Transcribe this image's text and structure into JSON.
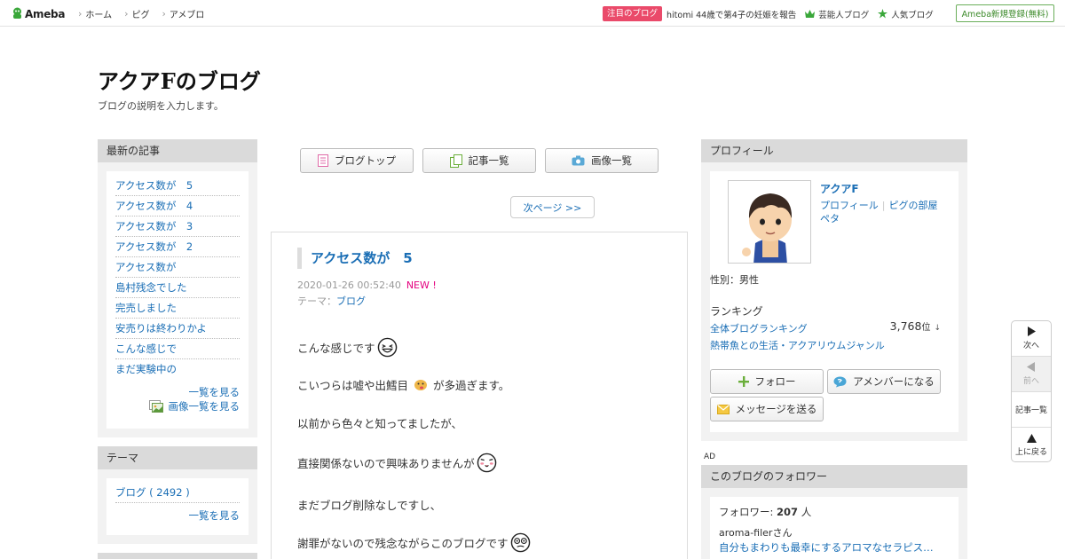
{
  "header": {
    "logo_text": "Ameba",
    "nav": [
      "ホーム",
      "ピグ",
      "アメブロ"
    ],
    "notice_badge": "注目のブログ",
    "notice_text": "hitomi 44歳で第4子の妊娠を報告",
    "celeb_blog": "芸能人ブログ",
    "popular_blog": "人気ブログ",
    "register": "Ameba新規登録(無料)"
  },
  "blog": {
    "title": "アクアFのブログ",
    "description": "ブログの説明を入力します。"
  },
  "recent": {
    "heading": "最新の記事",
    "items": [
      "アクセス数が　5",
      "アクセス数が　4",
      "アクセス数が　3",
      "アクセス数が　2",
      "アクセス数が",
      "島村残念でした",
      "完売しました",
      "安売りは終わりかよ",
      "こんな感じで",
      "まだ実験中の"
    ],
    "see_all": "一覧を見る",
    "image_list": "画像一覧を見る"
  },
  "theme": {
    "heading": "テーマ",
    "items": [
      "ブログ ( 2492 )"
    ],
    "see_all": "一覧を見る"
  },
  "tabs": {
    "blog_top": "ブログトップ",
    "article_list": "記事一覧",
    "image_list": "画像一覧"
  },
  "next_page": "次ページ >>",
  "article": {
    "title": "アクセス数が　5",
    "date": "2020-01-26 00:52:40",
    "new": "NEW !",
    "theme_label": "テーマ：",
    "theme": "ブログ",
    "paragraphs": [
      {
        "text": "こんな感じです",
        "emoji": "laugh-emoji"
      },
      {
        "text_before": "こいつらは嘘や出鱈目",
        "text_after": "が多過ぎます。",
        "emoji": "tongue-emoji"
      },
      {
        "text": "以前から色々と知ってましたが、"
      },
      {
        "text": "直接関係ないので興味ありませんが",
        "emoji": "blush-emoji"
      },
      {
        "text": "まだブログ削除なしですし、"
      },
      {
        "text": "謝罪がないので残念ながらこのブログです",
        "emoji": "surprised-emoji"
      }
    ]
  },
  "profile": {
    "heading": "プロフィール",
    "name": "アクアF",
    "links": [
      "プロフィール",
      "ピグの部屋",
      "ペタ"
    ],
    "gender": "性別：男性",
    "ranking_heading": "ランキング",
    "ranking_all": "全体ブログランキング",
    "ranking_value": "3,768",
    "ranking_unit": "位",
    "ranking_arrow": "↓",
    "genre": "熱帯魚との生活・アクアリウムジャンル",
    "follow": "フォロー",
    "member": "アメンバーになる",
    "message": "メッセージを送る"
  },
  "ad_label": "AD",
  "followers": {
    "heading": "このブログのフォロワー",
    "count_label": "フォロワー:",
    "count": "207",
    "count_unit": "人",
    "follower_name": "aroma-filerさん",
    "follower_blog": "自分もまわりも最幸にするアロマなセラピス…"
  },
  "pager": {
    "next": "次へ",
    "prev": "前へ",
    "list": "記事一覧",
    "top": "上に戻る"
  },
  "colors": {
    "link": "#1a6eb5",
    "new": "#e4007f",
    "badge": "#ea4a6a",
    "register": "#3c8a2a"
  }
}
